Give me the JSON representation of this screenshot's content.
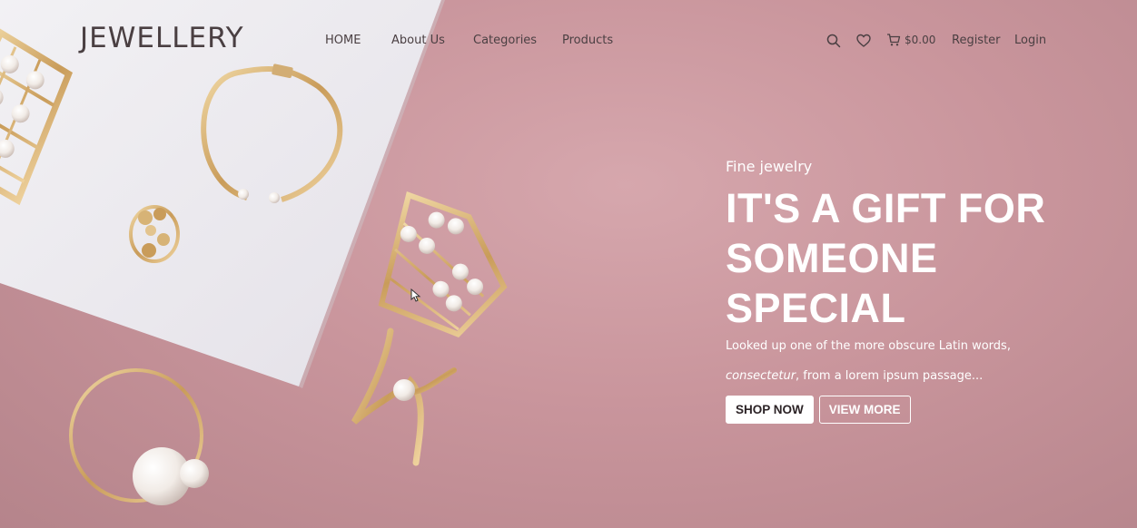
{
  "header": {
    "logo": "JEWELLERY",
    "nav": [
      {
        "label": "HOME"
      },
      {
        "label": "About Us"
      },
      {
        "label": "Categories"
      },
      {
        "label": "Products"
      }
    ],
    "cart_total": "$0.00",
    "register_label": "Register",
    "login_label": "Login",
    "icons": [
      "search-icon",
      "heart-icon",
      "cart-icon"
    ]
  },
  "hero": {
    "kicker": "Fine jewelry",
    "headline_line1": "IT'S A GIFT FOR",
    "headline_line2": "SOMEONE SPECIAL",
    "body_line1": "Looked up one of the more obscure Latin words,",
    "body_line2_em": "consectetur",
    "body_line2_rest": ", from a lorem ipsum passage...",
    "primary_button": "SHOP NOW",
    "secondary_button": "VIEW MORE"
  },
  "colors": {
    "background_pink": "#c99aa0",
    "board_white": "#ecebef",
    "gold": "#d9b67c",
    "text_dark": "#4a3f42",
    "text_light": "#ffffff"
  }
}
